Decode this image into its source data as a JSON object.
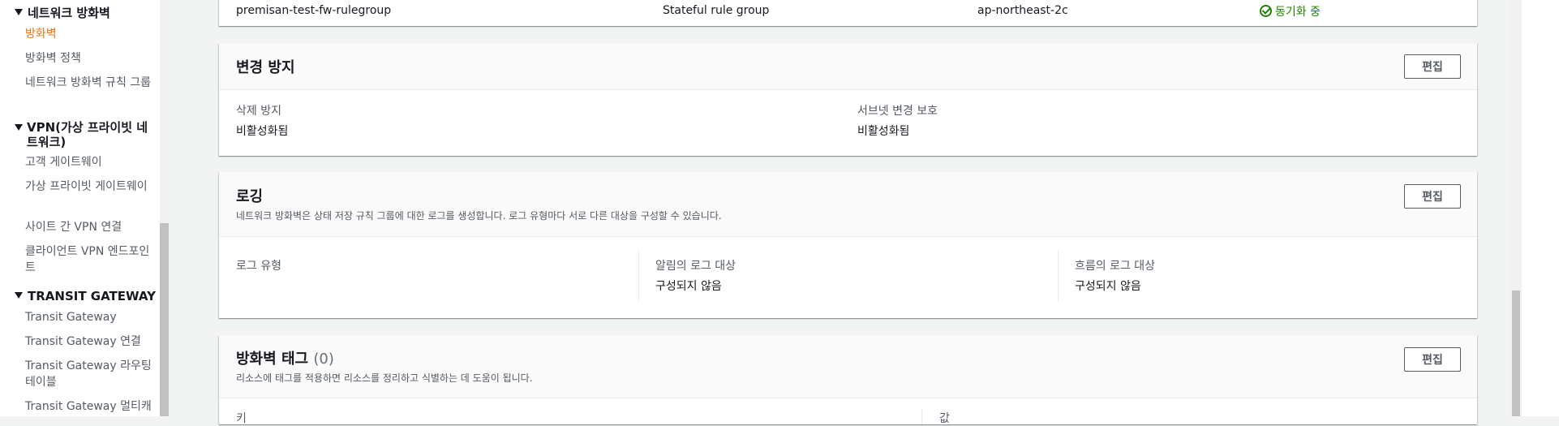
{
  "sidebar": {
    "network_firewall_section": "네트워크 방화벽",
    "firewalls": "방화벽",
    "firewall_policies": "방화벽 정책",
    "rule_groups": "네트워크 방화벽 규칙 그룹",
    "vpn_section": "VPN(가상 프라이빗 네트워크)",
    "customer_gateways": "고객 게이트웨이",
    "virtual_private_gateways": "가상 프라이빗 게이트웨이",
    "site_to_site_vpn": "사이트 간 VPN 연결",
    "client_vpn_endpoints": "클라이언트 VPN 엔드포인트",
    "tgw_section": "TRANSIT GATEWAY",
    "transit_gateways": "Transit Gateway",
    "tgw_attachments": "Transit Gateway 연결",
    "tgw_route_tables": "Transit Gateway 라우팅 테이블",
    "tgw_multicast": "Transit Gateway 멀티캐"
  },
  "rule_group_row": {
    "name": "premisan-test-fw-rulegroup",
    "type": "Stateful rule group",
    "az": "ap-northeast-2c",
    "status": "동기화 중"
  },
  "change_protection": {
    "title": "변경 방지",
    "edit": "편집",
    "delete_protection_label": "삭제 방지",
    "delete_protection_value": "비활성화됨",
    "subnet_protection_label": "서브넷 변경 보호",
    "subnet_protection_value": "비활성화됨"
  },
  "logging": {
    "title": "로깅",
    "description": "네트워크 방화벽은 상태 저장 규칙 그룹에 대한 로그를 생성합니다. 로그 유형마다 서로 다른 대상을 구성할 수 있습니다.",
    "edit": "편집",
    "log_type_label": "로그 유형",
    "alert_dest_label": "알림의 로그 대상",
    "alert_dest_value": "구성되지 않음",
    "flow_dest_label": "흐름의 로그 대상",
    "flow_dest_value": "구성되지 않음"
  },
  "tags": {
    "title": "방화벽 태그",
    "count": "(0)",
    "description": "리소스에 태그를 적용하면 리소스를 정리하고 식별하는 데 도움이 됩니다.",
    "edit": "편집",
    "col_key": "키",
    "col_value": "값"
  },
  "colors": {
    "active_nav": "#ec7211",
    "success": "#1d8102",
    "panel_header": "#fafafa"
  }
}
